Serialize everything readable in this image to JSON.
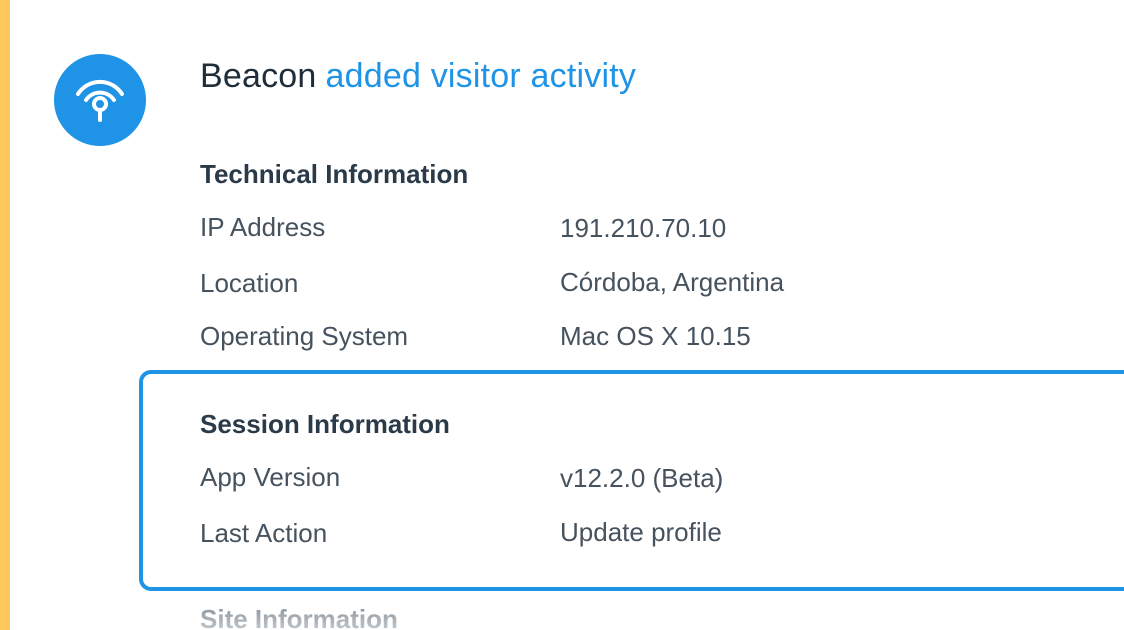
{
  "colors": {
    "accent_bar": "#FFC65C",
    "brand_blue": "#1F93E6",
    "heading_text": "#2B3A48",
    "body_text": "#46525D"
  },
  "event": {
    "icon": "beacon-signal-icon",
    "actor": "Beacon",
    "action": "added visitor activity"
  },
  "technical": {
    "title": "Technical Information",
    "rows": [
      {
        "label": "IP Address",
        "value": "191.210.70.10"
      },
      {
        "label": "Location",
        "value": "Córdoba, Argentina"
      },
      {
        "label": "Operating System",
        "value": "Mac OS X 10.15"
      }
    ]
  },
  "session": {
    "title": "Session Information",
    "rows": [
      {
        "label": "App Version",
        "value": "v12.2.0 (Beta)"
      },
      {
        "label": "Last Action",
        "value": "Update profile"
      }
    ]
  },
  "site": {
    "title": "Site Information"
  }
}
